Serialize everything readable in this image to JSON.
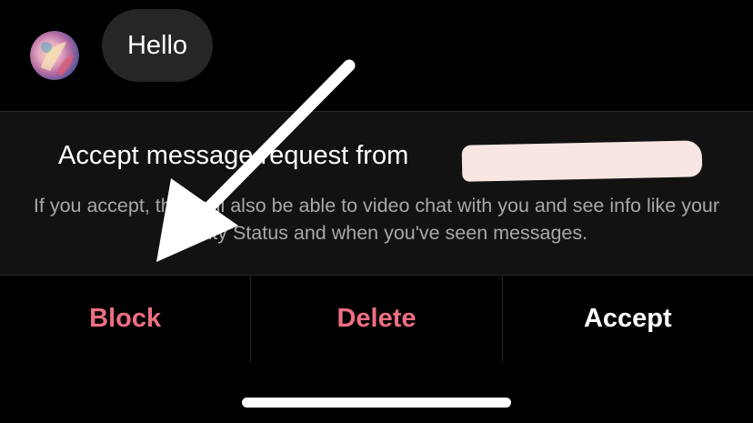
{
  "chat": {
    "avatar_alt": "profile photo",
    "message": "Hello"
  },
  "request": {
    "title": "Accept message request from",
    "description": "If you accept, they will also be able to video chat with you and see info like your Activity Status and when you've seen messages."
  },
  "actions": [
    {
      "label": "Block",
      "style": "danger"
    },
    {
      "label": "Delete",
      "style": "danger"
    },
    {
      "label": "Accept",
      "style": "primary"
    }
  ],
  "colors": {
    "background": "#000000",
    "panel": "#121212",
    "bubble": "#262626",
    "danger": "#ed6f81",
    "secondary_text": "#a8a8a8"
  },
  "icons": {
    "annotation": "arrow-pointer-icon"
  }
}
